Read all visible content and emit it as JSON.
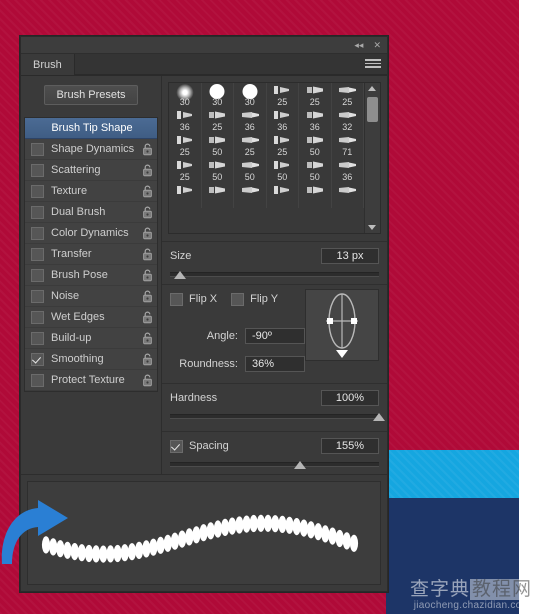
{
  "panel": {
    "title": "Brush",
    "tab_label": "Brush",
    "collapse_icon": "collapse-icon",
    "close_icon": "close-icon",
    "menu_icon": "panel-menu-icon",
    "presets_button": "Brush Presets"
  },
  "options": {
    "header": "Brush Tip Shape",
    "items": [
      {
        "label": "Shape Dynamics",
        "checked": false,
        "locked": false
      },
      {
        "label": "Scattering",
        "checked": false,
        "locked": false
      },
      {
        "label": "Texture",
        "checked": false,
        "locked": false
      },
      {
        "label": "Dual Brush",
        "checked": false,
        "locked": false
      },
      {
        "label": "Color Dynamics",
        "checked": false,
        "locked": false
      },
      {
        "label": "Transfer",
        "checked": false,
        "locked": false
      },
      {
        "label": "Brush Pose",
        "checked": false,
        "locked": false
      },
      {
        "label": "Noise",
        "checked": false,
        "locked": false
      },
      {
        "label": "Wet Edges",
        "checked": false,
        "locked": false
      },
      {
        "label": "Build-up",
        "checked": false,
        "locked": false
      },
      {
        "label": "Smoothing",
        "checked": true,
        "locked": false
      },
      {
        "label": "Protect Texture",
        "checked": false,
        "locked": false
      }
    ]
  },
  "brush_tips": {
    "rows": [
      [
        {
          "size": "30",
          "kind": "soft-round"
        },
        {
          "size": "30",
          "kind": "hard-round"
        },
        {
          "size": "30",
          "kind": "hard-round"
        },
        {
          "size": "25",
          "kind": "bristle"
        },
        {
          "size": "25",
          "kind": "bristle"
        },
        {
          "size": "25",
          "kind": "bristle"
        }
      ],
      [
        {
          "size": "36",
          "kind": "bristle"
        },
        {
          "size": "25",
          "kind": "bristle"
        },
        {
          "size": "36",
          "kind": "bristle"
        },
        {
          "size": "36",
          "kind": "bristle"
        },
        {
          "size": "36",
          "kind": "bristle"
        },
        {
          "size": "32",
          "kind": "bristle"
        }
      ],
      [
        {
          "size": "25",
          "kind": "bristle"
        },
        {
          "size": "50",
          "kind": "bristle"
        },
        {
          "size": "25",
          "kind": "bristle"
        },
        {
          "size": "25",
          "kind": "bristle"
        },
        {
          "size": "50",
          "kind": "bristle"
        },
        {
          "size": "71",
          "kind": "bristle"
        }
      ],
      [
        {
          "size": "25",
          "kind": "bristle"
        },
        {
          "size": "50",
          "kind": "bristle"
        },
        {
          "size": "50",
          "kind": "bristle"
        },
        {
          "size": "50",
          "kind": "bristle"
        },
        {
          "size": "50",
          "kind": "bristle"
        },
        {
          "size": "36",
          "kind": "bristle"
        }
      ],
      [
        {
          "size": "",
          "kind": "bristle"
        },
        {
          "size": "",
          "kind": "bristle"
        },
        {
          "size": "",
          "kind": "bristle"
        },
        {
          "size": "",
          "kind": "bristle"
        },
        {
          "size": "",
          "kind": "bristle"
        },
        {
          "size": "",
          "kind": "bristle"
        }
      ]
    ]
  },
  "controls": {
    "size_label": "Size",
    "size_value": "13 px",
    "size_slider_percent": 5,
    "flip_x_label": "Flip X",
    "flip_x_checked": false,
    "flip_y_label": "Flip Y",
    "flip_y_checked": false,
    "angle_label": "Angle:",
    "angle_value": "-90º",
    "roundness_label": "Roundness:",
    "roundness_value": "36%",
    "hardness_label": "Hardness",
    "hardness_value": "100%",
    "hardness_slider_percent": 100,
    "spacing_label": "Spacing",
    "spacing_checked": true,
    "spacing_value": "155%",
    "spacing_slider_percent": 62
  },
  "colors": {
    "panel_bg": "#3a3a3a",
    "header_blue": "#44628b",
    "canvas_crimson": "#b00a38",
    "band_cyan": "#15a6e0",
    "band_navy": "#1d3567",
    "arrow_blue": "#2a7fd4"
  },
  "annotation": {
    "arrow_icon": "curved-arrow-icon"
  },
  "watermark": {
    "cn_part1": "查字典",
    "cn_part2": "教程网",
    "url": "jiaocheng.chazidian.com"
  }
}
